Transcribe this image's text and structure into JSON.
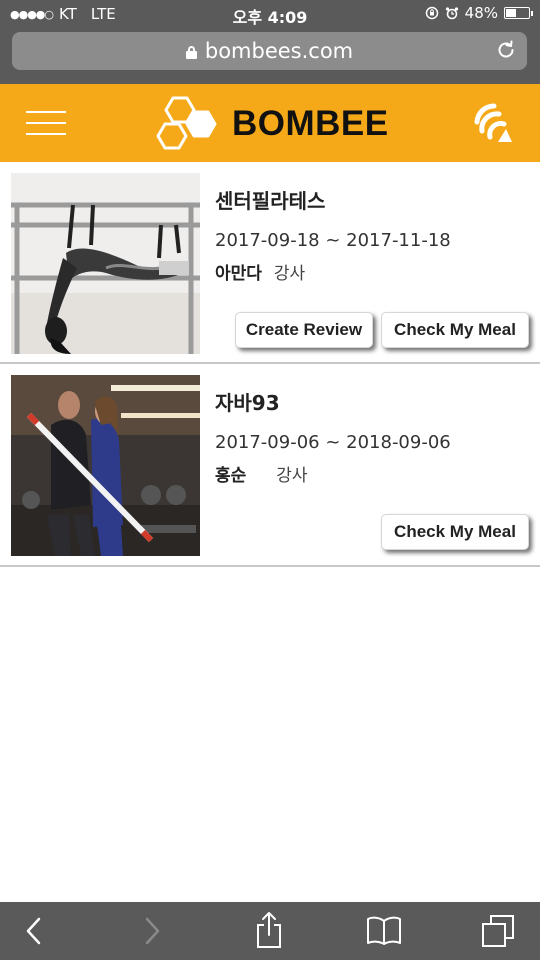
{
  "status_bar": {
    "signal": "●●●●○",
    "carrier": "KT",
    "network": "LTE",
    "time": "오후 4:09",
    "battery_percent": "48%",
    "battery_level": 0.48
  },
  "browser": {
    "url": "bombees.com",
    "icons": [
      "lock-icon",
      "reload-icon",
      "back-icon",
      "forward-icon",
      "share-icon",
      "bookmarks-icon",
      "tabs-icon"
    ]
  },
  "header": {
    "brand": "BOMBEE",
    "accent_color": "#f5a818",
    "icons": [
      "menu-icon",
      "honeycomb-logo-icon",
      "wifi-signal-icon"
    ]
  },
  "classes": [
    {
      "title": "센터필라테스",
      "dates": "2017-09-18 ~ 2017-11-18",
      "instructor": "아만다",
      "role": "강사",
      "image": "pilates-photo",
      "buttons": [
        "Create Review",
        "Check My Meal"
      ]
    },
    {
      "title": "자바93",
      "dates": "2017-09-06 ~ 2018-09-06",
      "instructor": "홍순",
      "role": "강사",
      "image": "gym-training-photo",
      "buttons": [
        "Check My Meal"
      ]
    }
  ]
}
